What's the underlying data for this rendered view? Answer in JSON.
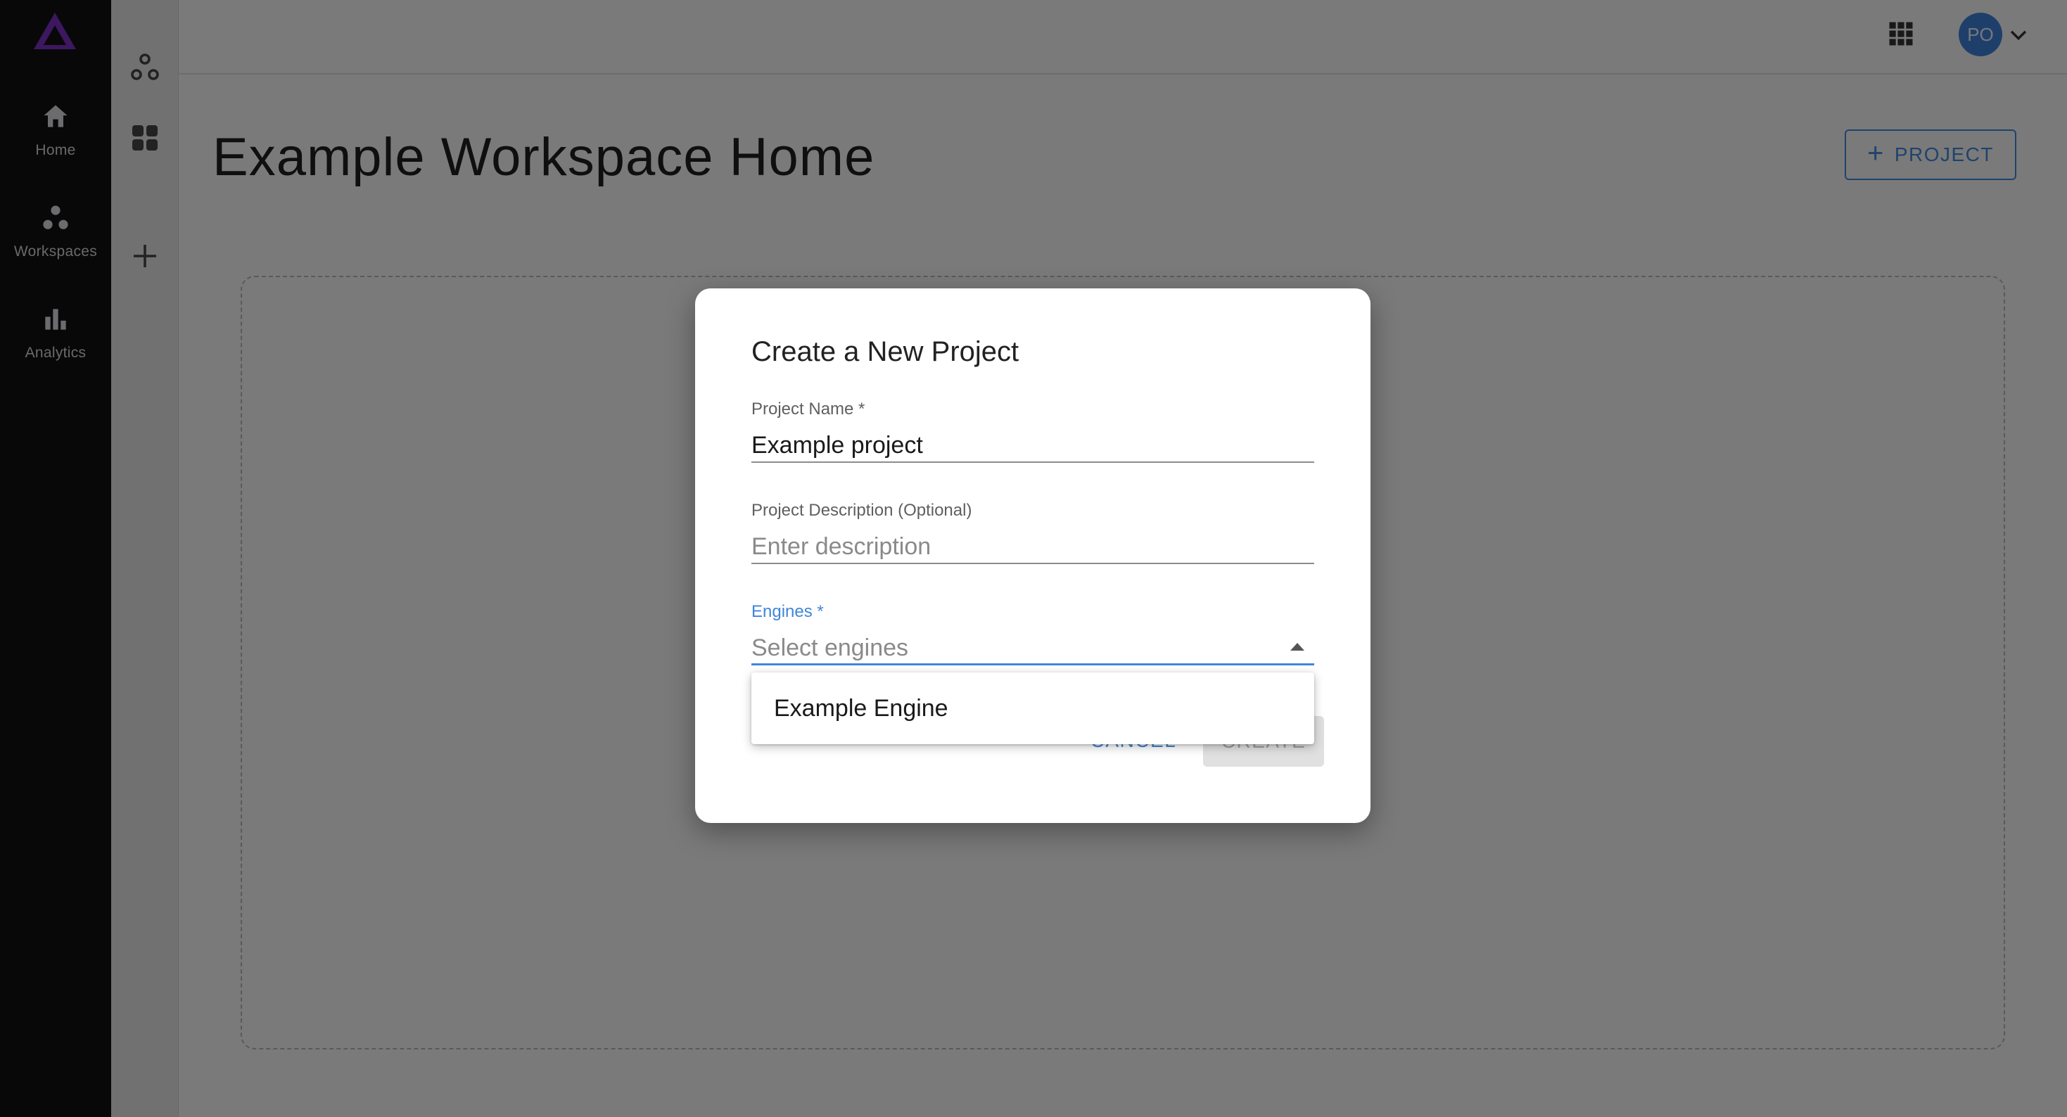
{
  "nav": {
    "items": [
      {
        "label": "Home",
        "icon": "home-icon"
      },
      {
        "label": "Workspaces",
        "icon": "workspaces-icon"
      },
      {
        "label": "Analytics",
        "icon": "bar-chart-icon"
      }
    ]
  },
  "topbar": {
    "avatar_initials": "PO"
  },
  "main": {
    "title": "Example Workspace Home",
    "project_button_label": "PROJECT"
  },
  "dialog": {
    "title": "Create a New Project",
    "project_name_label": "Project Name *",
    "project_name_value": "Example project",
    "description_label": "Project Description (Optional)",
    "description_placeholder": "Enter description",
    "engines_label": "Engines *",
    "engines_placeholder": "Select engines",
    "cancel_label": "CANCEL",
    "create_label": "CREATE"
  },
  "engines_menu": {
    "options": [
      "Example Engine"
    ]
  },
  "colors": {
    "accent": "#3f86d8",
    "logo": "#7b2fbe",
    "rail": "#111113"
  }
}
